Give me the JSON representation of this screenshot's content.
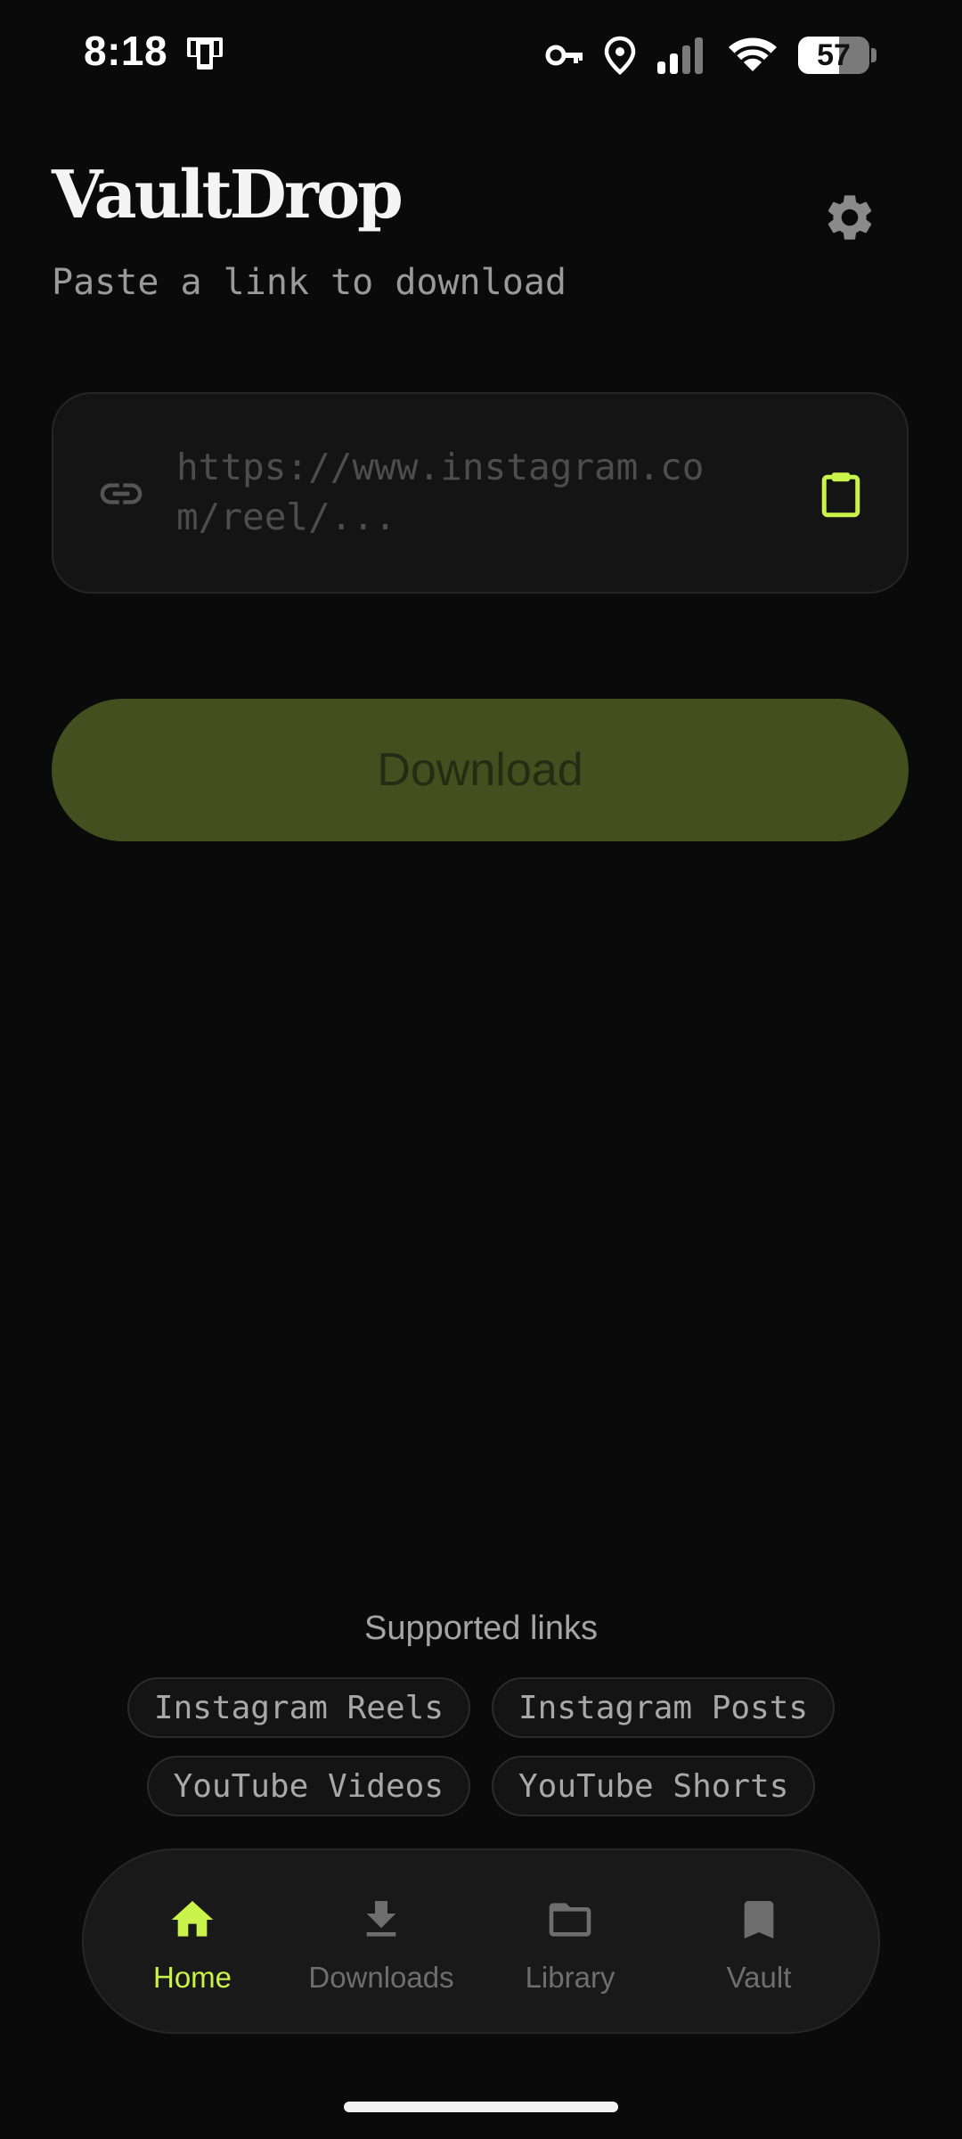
{
  "status_bar": {
    "time": "8:18",
    "battery_level": "57",
    "battery_fraction": 0.57,
    "icons": [
      "phone-portrait-icon",
      "key-icon",
      "location-icon",
      "signal-icon",
      "wifi-icon",
      "battery-icon"
    ]
  },
  "header": {
    "title": "VaultDrop",
    "subtitle": "Paste a link to download",
    "settings_icon": "gear-icon"
  },
  "url_input": {
    "value": "",
    "placeholder": "https://www.instagram.com/reel/...",
    "leading_icon": "link-icon",
    "paste_icon": "clipboard-icon"
  },
  "download_button": {
    "label": "Download"
  },
  "supported": {
    "title": "Supported links",
    "row1": [
      "Instagram Reels",
      "Instagram Posts"
    ],
    "row2": [
      "YouTube Videos",
      "YouTube Shorts"
    ]
  },
  "bottom_nav": {
    "active": "home",
    "items": [
      {
        "id": "home",
        "label": "Home",
        "icon": "home-icon"
      },
      {
        "id": "downloads",
        "label": "Downloads",
        "icon": "download-icon"
      },
      {
        "id": "library",
        "label": "Library",
        "icon": "folder-icon"
      },
      {
        "id": "vault",
        "label": "Vault",
        "icon": "bookmark-icon"
      }
    ]
  },
  "colors": {
    "background": "#0a0a0a",
    "accent": "#c9f24a",
    "download_button_disabled": "#434f1f",
    "card": "#141414",
    "nav_inactive": "#6e6e6e"
  }
}
